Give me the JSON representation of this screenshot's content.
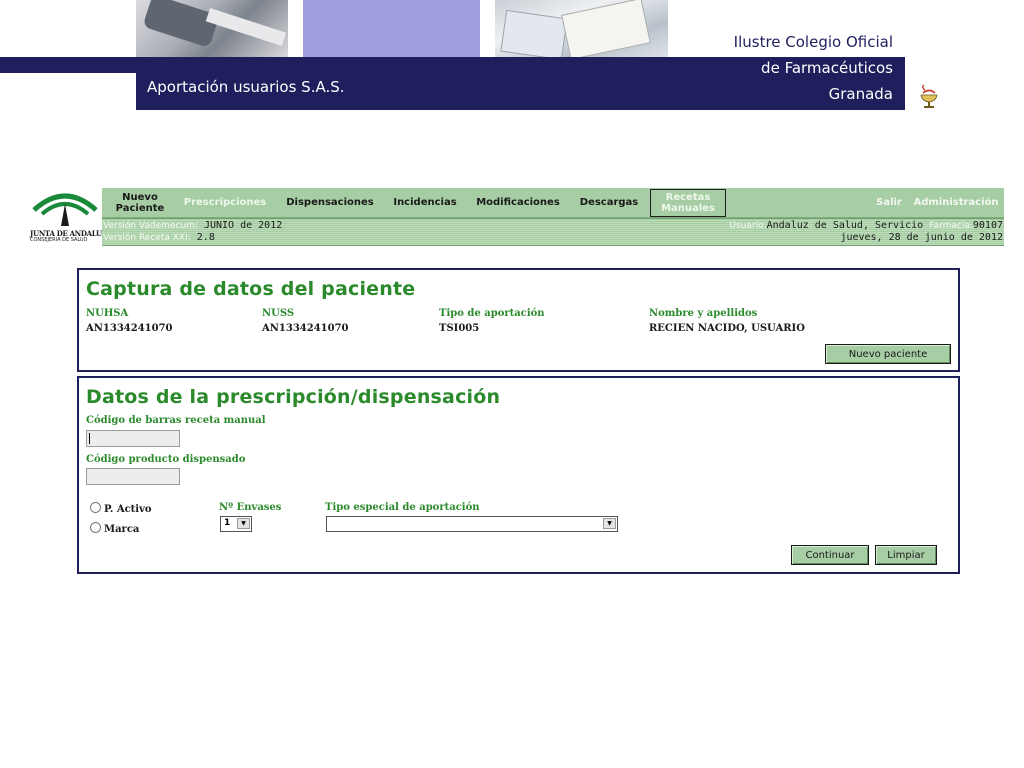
{
  "header": {
    "subtitle": "Aportación usuarios S.A.S.",
    "college_line1": "Ilustre Colegio Oficial",
    "college_line2": "de Farmacéuticos",
    "college_line3": "Granada",
    "brand_dark": "#1f1f5e",
    "brand_lilac": "#9f9fde"
  },
  "app_logo": {
    "line1": "JUNTA DE ANDALUCIA",
    "line2": "CONSEJERIA DE SALUD"
  },
  "nav": {
    "items": [
      {
        "label": "Nuevo\nPaciente"
      },
      {
        "label": "Prescripciones"
      },
      {
        "label": "Dispensaciones"
      },
      {
        "label": "Incidencias"
      },
      {
        "label": "Modificaciones"
      },
      {
        "label": "Descargas"
      },
      {
        "label": "Recetas\nManuales"
      }
    ],
    "salir": "Salir",
    "admin": "Administración",
    "bar_color": "#a6cda4"
  },
  "info": {
    "vademecum_label": "Versión Vademecum:",
    "vademecum_value": "JUNIO de 2012",
    "receta_label": "Versión Receta XXI:",
    "receta_value": "2.8",
    "usuario_label": "Usuario:",
    "usuario_value": "Andaluz de Salud, Servicio",
    "farmacia_label": "Farmacia:",
    "farmacia_value": "90107",
    "date": "jueves, 28 de junio de 2012"
  },
  "patient": {
    "title": "Captura de datos del paciente",
    "cols": [
      {
        "label": "NUHSA",
        "value": "AN1334241070"
      },
      {
        "label": "NUSS",
        "value": "AN1334241070"
      },
      {
        "label": "Tipo de aportación",
        "value": "TSI005"
      },
      {
        "label": "Nombre y apellidos",
        "value": "RECIEN NACIDO, USUARIO"
      }
    ],
    "new_button": "Nuevo paciente"
  },
  "prescription": {
    "title": "Datos de la prescripción/dispensación",
    "barcode_label": "Código de barras receta manual",
    "barcode_value": "",
    "product_label": "Código producto dispensado",
    "product_value": "",
    "radio_active": "P. Activo",
    "radio_brand": "Marca",
    "envases_label": "Nº Envases",
    "envases_value": "1",
    "tipo_label": "Tipo especial de aportación",
    "tipo_value": "",
    "continue_button": "Continuar",
    "clear_button": "Limpiar"
  }
}
